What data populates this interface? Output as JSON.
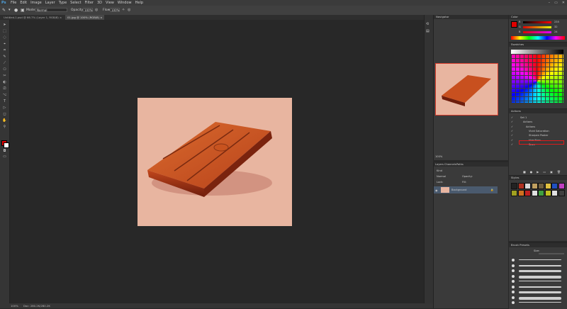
{
  "app": {
    "logo": "Ps"
  },
  "menu": [
    "File",
    "Edit",
    "Image",
    "Layer",
    "Type",
    "Select",
    "Filter",
    "3D",
    "View",
    "Window",
    "Help"
  ],
  "window_controls": [
    "–",
    "▭",
    "✕"
  ],
  "options": {
    "mode_label": "Mode:",
    "mode_value": "Normal",
    "opacity_label": "Opacity:",
    "opacity_value": "100%",
    "flow_label": "Flow:",
    "flow_value": "100%"
  },
  "tabs": [
    {
      "label": "Untitled-1.psd @ 66.7% (Layer 1, RGB/8) ×",
      "active": false
    },
    {
      "label": "01.jpg @ 100% (RGB/8) ×",
      "active": true
    }
  ],
  "tools": [
    "➤",
    "⬚",
    "◌",
    "⌖",
    "⌗",
    "✎",
    "⟋",
    "⎔",
    "✂",
    "◐",
    "⎚",
    "⌥",
    "T",
    "▷",
    "◻",
    "✋",
    "⚲"
  ],
  "status": {
    "zoom": "100%",
    "doc": "Doc: 280.2K/280.2K"
  },
  "navigator": {
    "title": "Navigator",
    "zoom": "100%"
  },
  "layers": {
    "tabs": [
      "Layers",
      "Channels",
      "Paths"
    ],
    "kind": "Kind",
    "blend": "Normal",
    "opacity_label": "Opacity:",
    "lock_label": "Lock:",
    "fill_label": "Fill:",
    "layer_name": "Background"
  },
  "color": {
    "title": "Color",
    "r": "R",
    "g": "G",
    "b": "B",
    "r_val": "235",
    "g_val": "32",
    "b_val": "24"
  },
  "swatches": {
    "title": "Swatches"
  },
  "actions": {
    "title": "Actions",
    "items": [
      "Set 1",
      "Actions",
      "Actions",
      "Vivid Saturation",
      "Sharpen Poster",
      "Hue Burn",
      "Save"
    ]
  },
  "styles": {
    "title": "Styles"
  },
  "brush_presets": {
    "title": "Brush Presets",
    "size_label": "Size:",
    "size_value": ""
  },
  "colors": {
    "accent": "#c8201a",
    "highlight": "#e01a1a",
    "fg": "#e00000",
    "canvas": "#e8b5a0"
  }
}
